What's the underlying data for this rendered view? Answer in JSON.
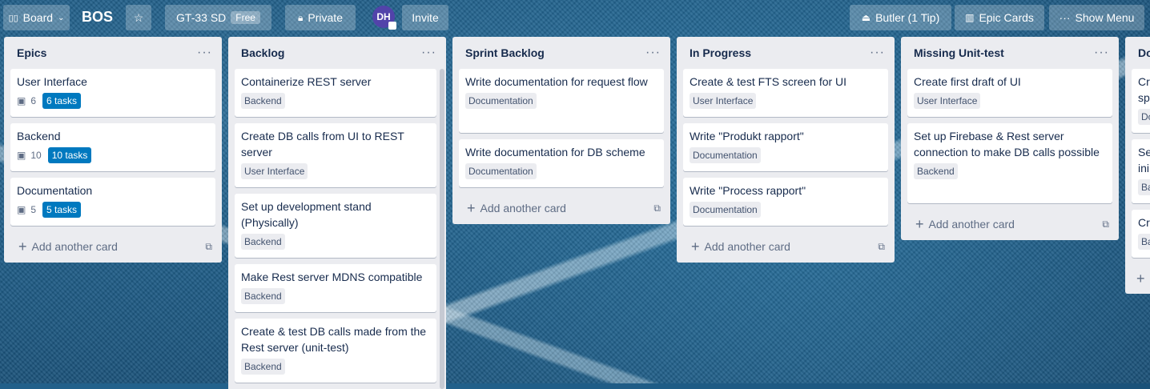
{
  "header": {
    "board_switch": "Board",
    "board_name": "BOS",
    "team": "GT-33 SD",
    "team_badge": "Free",
    "visibility": "Private",
    "avatar_initials": "DH",
    "invite": "Invite",
    "butler": "Butler (1 Tip)",
    "epic_cards": "Epic Cards",
    "show_menu": "Show Menu"
  },
  "lists": [
    {
      "title": "Epics",
      "cards": [
        {
          "title": "User Interface",
          "count": "6",
          "tasks": "6 tasks"
        },
        {
          "title": "Backend",
          "count": "10",
          "tasks": "10 tasks"
        },
        {
          "title": "Documentation",
          "count": "5",
          "tasks": "5 tasks"
        }
      ],
      "add": "Add another card"
    },
    {
      "title": "Backlog",
      "cards": [
        {
          "title": "Containerize REST server",
          "label": "Backend"
        },
        {
          "title": "Create DB calls from UI to REST server",
          "label": "User Interface"
        },
        {
          "title": "Set up development stand (Physically)",
          "label": "Backend"
        },
        {
          "title": "Make Rest server MDNS compatible",
          "label": "Backend"
        },
        {
          "title": "Create & test DB calls made from the Rest server (unit-test)",
          "label": "Backend"
        }
      ]
    },
    {
      "title": "Sprint Backlog",
      "cards": [
        {
          "title": "Write documentation for request flow",
          "label": "Documentation"
        },
        {
          "title": "Write documentation for DB scheme",
          "label": "Documentation"
        }
      ],
      "add": "Add another card"
    },
    {
      "title": "In Progress",
      "cards": [
        {
          "title": "Create & test FTS screen for UI",
          "label": "User Interface"
        },
        {
          "title": "Write \"Produkt rapport\"",
          "label": "Documentation"
        },
        {
          "title": "Write \"Process rapport\"",
          "label": "Documentation"
        }
      ],
      "add": "Add another card"
    },
    {
      "title": "Missing Unit-test",
      "cards": [
        {
          "title": "Create first draft of UI",
          "label": "User Interface"
        },
        {
          "title": "Set up Firebase & Rest server connection to make DB calls possible",
          "label": "Backend"
        }
      ],
      "add": "Add another card"
    },
    {
      "title": "Do",
      "cards": [
        {
          "title": "Cr sp",
          "label": "Do"
        },
        {
          "title": "Se ini",
          "label": "Ba"
        },
        {
          "title": "Cr",
          "label": "Ba"
        }
      ]
    }
  ],
  "colors": {
    "accent": "#0079bf",
    "list_bg": "#ebecf0",
    "avatar": "#5243aa"
  },
  "icons": [
    "board-icon",
    "chevron-down-icon",
    "star-icon",
    "lock-icon",
    "bell-icon",
    "chart-icon",
    "ellipsis-icon",
    "description-icon",
    "plus-icon",
    "template-icon"
  ]
}
